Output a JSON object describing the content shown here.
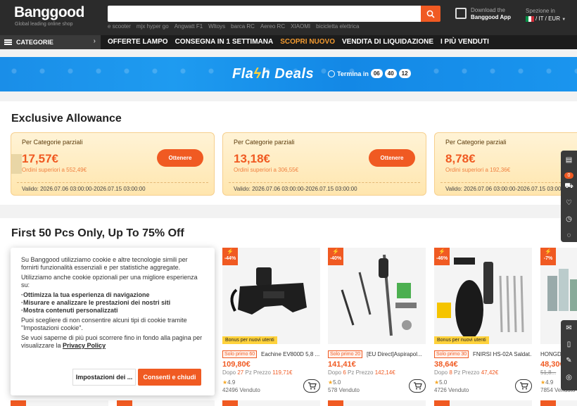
{
  "header": {
    "logo": "Banggood",
    "tagline": "Global leading online shop",
    "search_placeholder": "",
    "hot_searches": [
      "e scooter",
      "mjx hyper go",
      "Angwatt F1",
      "Wltoys",
      "barca RC",
      "Aereo RC",
      "XIAOMI",
      "bicicletta elettrica"
    ],
    "app_line1": "Download the",
    "app_line2": "Banggood App",
    "ship_label": "Spezione in",
    "ship_value": "/ IT / EUR"
  },
  "nav": {
    "category": "CATEGORIE",
    "items": [
      "OFFERTE LAMPO",
      "CONSEGNA IN 1 SETTIMANA",
      "SCOPRI NUOVO",
      "VENDITA DI LIQUIDAZIONE",
      "I PIÙ VENDUTI"
    ],
    "highlight_index": 2
  },
  "flash": {
    "title_a": "Fla",
    "title_bolt": "ϟ",
    "title_b": "h Deals",
    "ends_label": "Termina in",
    "hh": "06",
    "mm": "40",
    "ss": "12"
  },
  "allowance": {
    "title": "Exclusive Allowance",
    "coupons": [
      {
        "label": "Per Categorie parziali",
        "amount": "17,57€",
        "min": "Ordini superiori a 552,49€",
        "button": "Ottenere",
        "valid": "Valido: 2026.07.06 03:00:00-2026.07.15 03:00:00"
      },
      {
        "label": "Per Categorie parziali",
        "amount": "13,18€",
        "min": "Ordini superiori a 306,55€",
        "button": "Ottenere",
        "valid": "Valido: 2026.07.06 03:00:00-2026.07.15 03:00:00"
      },
      {
        "label": "Per Categorie parziali",
        "amount": "8,78€",
        "min": "Ordini superiori a 192,36€",
        "button": "Ottenere",
        "valid": "Valido: 2026.07.06 03:00:00-2026.07.15 03:00:00"
      }
    ]
  },
  "first50": {
    "title": "First 50 Pcs Only, Up To 75% Off",
    "products": [
      {
        "disc": "-44%",
        "bonus": "Bonus per nuovi utenti",
        "tag": "Solo primo 60",
        "name": "Eachine EV800D 5,8 ...",
        "price": "109,80€",
        "dopo": "Dopo ",
        "dopo_n": "27",
        "dopo_tail": " Pz Prezzo ",
        "dopo_price": "119,71€",
        "rating": "4.9",
        "sold": "42496 Venduto"
      },
      {
        "disc": "-40%",
        "bonus": "",
        "tag": "Solo primo 20",
        "name": "[EU Direct]Aspirapol...",
        "price": "141,41€",
        "dopo": "Dopo ",
        "dopo_n": "6",
        "dopo_tail": " Pz Prezzo ",
        "dopo_price": "142,14€",
        "rating": "5.0",
        "sold": "578 Venduto"
      },
      {
        "disc": "-46%",
        "bonus": "Bonus per nuovi utenti",
        "tag": "Solo primo 30",
        "name": "FNIRSI HS-02A Saldat...",
        "price": "38,64€",
        "dopo": "Dopo ",
        "dopo_n": "8",
        "dopo_tail": " Pz Prezzo ",
        "dopo_price": "47,42€",
        "rating": "5.0",
        "sold": "4726 Venduto"
      },
      {
        "disc": "-7%",
        "bonus": "",
        "tag": "",
        "name": "HONGD...",
        "price": "48,30€",
        "dopo": "",
        "dopo_n": "",
        "dopo_tail": "",
        "dopo_price": "51,8...",
        "rating": "4.9",
        "sold": "7854 Venduto"
      }
    ]
  },
  "cookie": {
    "intro": "Su Banggood utilizziamo cookie e altre tecnologie simili per fornirti funzionalità essenziali e per statistiche aggregate.",
    "optional": "Utilizziamo anche cookie opzionali per una migliore esperienza su:",
    "b1": "·Ottimizza la tua esperienza di navigazione",
    "b2": "·Misurare e analizzare le prestazioni dei nostri siti",
    "b3": "·Mostra contenuti personalizzati",
    "choose": "Puoi scegliere di non consentire alcuni tipi di cookie tramite \"Impostazioni cookie\".",
    "more": "Se vuoi saperne di più puoi scorrere fino in fondo alla pagina per visualizzare la ",
    "policy": "Privacy Policy",
    "settings_btn": "Impostazioni dei ...",
    "accept_btn": "Consenti e chiudi"
  },
  "sidebar": {
    "cart_count": "0"
  },
  "colors": {
    "accent": "#f05a22",
    "header_bg": "#2b2b2b",
    "flash_bg": "#1a8ee8"
  }
}
